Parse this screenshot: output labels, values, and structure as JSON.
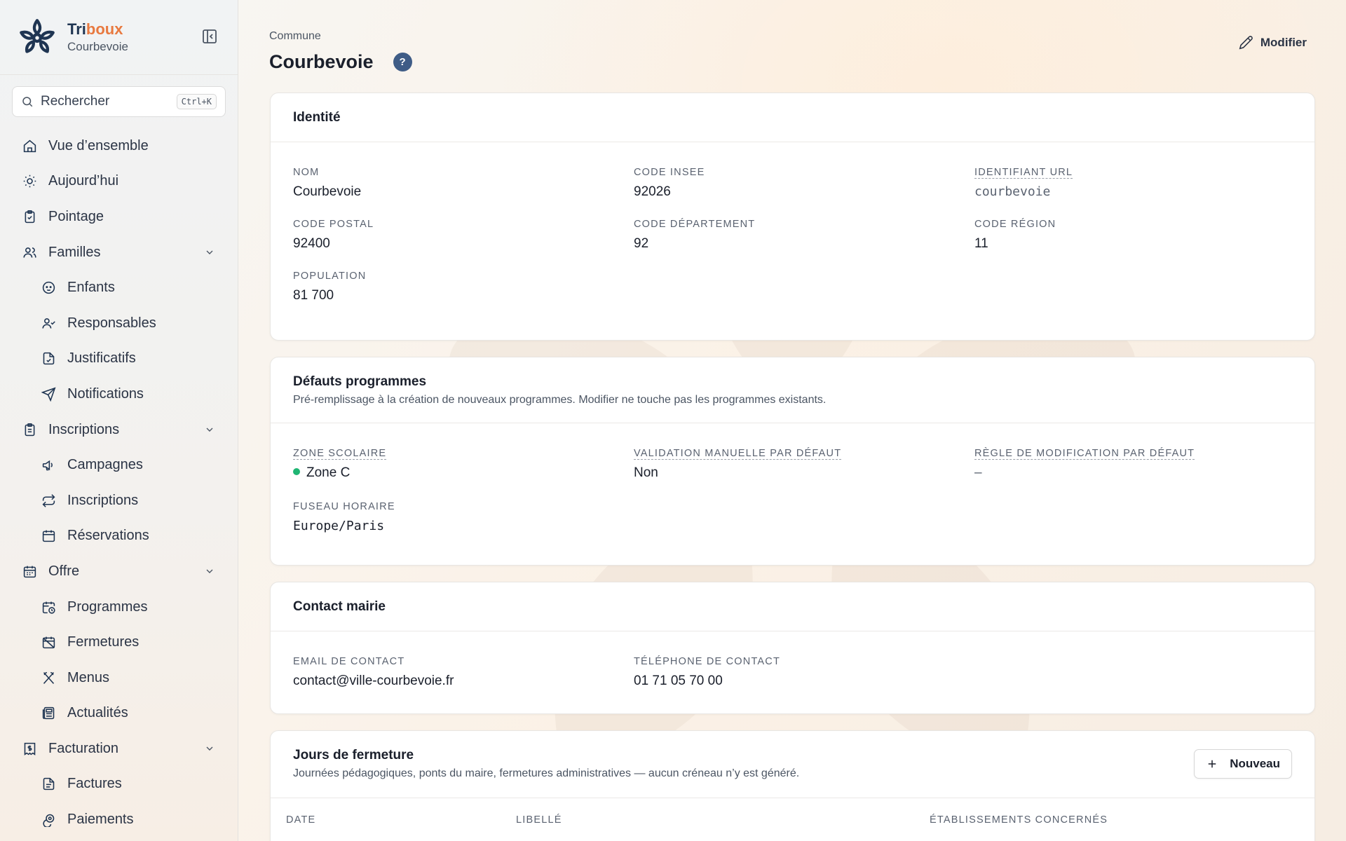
{
  "brand": {
    "name_primary": "Tri",
    "name_accent": "boux",
    "subtitle": "Courbevoie"
  },
  "search": {
    "placeholder": "Rechercher",
    "shortcut": "Ctrl+K"
  },
  "sidebar": {
    "items": [
      {
        "label": "Vue d’ensemble",
        "icon": "home-icon"
      },
      {
        "label": "Aujourd’hui",
        "icon": "sun-icon"
      },
      {
        "label": "Pointage",
        "icon": "clipboard-check-icon"
      },
      {
        "label": "Familles",
        "icon": "users-icon",
        "expanded": true
      },
      {
        "label": "Enfants",
        "icon": "baby-icon"
      },
      {
        "label": "Responsables",
        "icon": "user-check-icon"
      },
      {
        "label": "Justificatifs",
        "icon": "file-check-icon"
      },
      {
        "label": "Notifications",
        "icon": "send-icon"
      },
      {
        "label": "Inscriptions",
        "icon": "clipboard-list-icon",
        "expanded": true
      },
      {
        "label": "Campagnes",
        "icon": "megaphone-icon"
      },
      {
        "label": "Inscriptions",
        "icon": "repeat-icon"
      },
      {
        "label": "Réservations",
        "icon": "calendar-icon"
      },
      {
        "label": "Offre",
        "icon": "calendar-days-icon",
        "expanded": true
      },
      {
        "label": "Programmes",
        "icon": "calendar-clock-icon"
      },
      {
        "label": "Fermetures",
        "icon": "calendar-x-icon"
      },
      {
        "label": "Menus",
        "icon": "utensils-icon"
      },
      {
        "label": "Actualités",
        "icon": "newspaper-icon"
      },
      {
        "label": "Facturation",
        "icon": "receipt-icon",
        "expanded": true
      },
      {
        "label": "Factures",
        "icon": "file-text-icon"
      },
      {
        "label": "Paiements",
        "icon": "coins-icon"
      }
    ]
  },
  "header": {
    "breadcrumb": "Commune",
    "title": "Courbevoie",
    "help": "?",
    "modify_label": "Modifier"
  },
  "identity": {
    "title": "Identité",
    "nom_label": "NOM",
    "nom": "Courbevoie",
    "insee_label": "CODE INSEE",
    "insee": "92026",
    "slug_label": "IDENTIFIANT URL",
    "slug": "courbevoie",
    "postal_label": "CODE POSTAL",
    "postal": "92400",
    "dept_label": "CODE DÉPARTEMENT",
    "dept": "92",
    "region_label": "CODE RÉGION",
    "region": "11",
    "population_label": "POPULATION",
    "population": "81 700"
  },
  "defaults": {
    "title": "Défauts programmes",
    "description": "Pré-remplissage à la création de nouveaux programmes. Modifier ne touche pas les programmes existants.",
    "zone_label": "ZONE SCOLAIRE",
    "zone": "Zone C",
    "zone_color": "#1fb573",
    "validation_label": "VALIDATION MANUELLE PAR DÉFAUT",
    "validation": "Non",
    "rule_label": "RÈGLE DE MODIFICATION PAR DÉFAUT",
    "rule": "–",
    "tz_label": "FUSEAU HORAIRE",
    "tz": "Europe/Paris"
  },
  "contact": {
    "title": "Contact mairie",
    "email_label": "EMAIL DE CONTACT",
    "email": "contact@ville-courbevoie.fr",
    "phone_label": "TÉLÉPHONE DE CONTACT",
    "phone": "01 71 05 70 00"
  },
  "closures": {
    "title": "Jours de fermeture",
    "description": "Journées pédagogiques, ponts du maire, fermetures administratives — aucun créneau n’y est généré.",
    "new_label": "Nouveau",
    "columns": [
      "DATE",
      "LIBELLÉ",
      "ÉTABLISSEMENTS CONCERNÉS"
    ]
  },
  "colors": {
    "accent": "#e8793f",
    "brand": "#1f3552",
    "help_badge": "#3f5c86"
  }
}
